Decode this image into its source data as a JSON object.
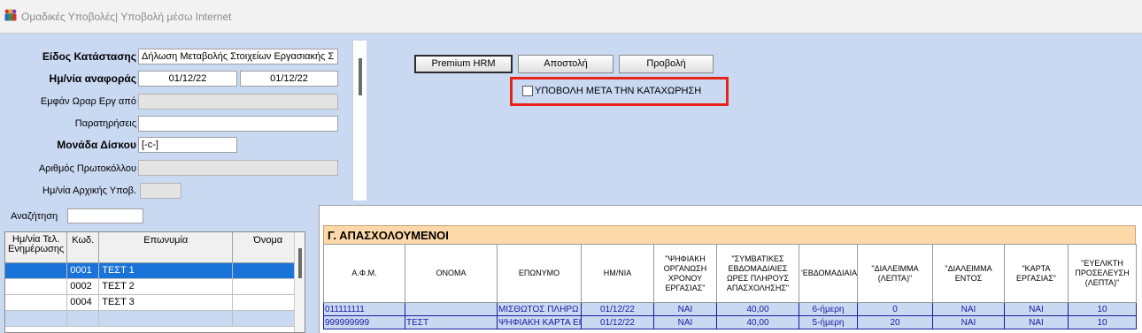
{
  "window": {
    "title": "Ομαδικές Υποβολές| Υποβολή μέσω Internet",
    "icon": "people-icon"
  },
  "form": {
    "type_label": "Είδος Κατάστασης",
    "type_value": "Δήλωση Μεταβολής Στοιχείων Εργασιακής Σ",
    "ref_date_label": "Ημ/νία αναφοράς",
    "ref_date_from": "01/12/22",
    "ref_date_to": "01/12/22",
    "show_hours_label": "Εμφάν Ωραρ Εργ από",
    "show_hours_value": "",
    "remarks_label": "Παρατηρήσεις",
    "remarks_value": "",
    "disk_label": "Μονάδα Δίσκου",
    "disk_value": "[-c-]",
    "protocol_label": "Αριθμός Πρωτοκόλλου",
    "protocol_value": "",
    "initial_date_label": "Ημ/νία Αρχικής Υποβ.",
    "initial_date_value": ""
  },
  "toolbar": {
    "premium_label": "Premium HRM",
    "send_label": "Αποστολή",
    "view_label": "Προβολή"
  },
  "option": {
    "checkbox_label": "ΥΠΟΒΟΛΗ ΜΕΤΑ ΤΗΝ ΚΑΤΑΧΩΡΗΣΗ",
    "checked": false,
    "highlight_color": "#e8231a"
  },
  "search": {
    "label": "Αναζήτηση",
    "value": ""
  },
  "left_grid": {
    "columns": [
      "Ημ/νία Τελ. Ενημέρωσης",
      "Κωδ.",
      "Επωνυμία",
      "Όνομα"
    ],
    "rows": [
      {
        "date": "",
        "code": "0001",
        "name": "ΤΕΣΤ 1",
        "first": "",
        "selected": true
      },
      {
        "date": "",
        "code": "0002",
        "name": "ΤΕΣΤ 2",
        "first": ""
      },
      {
        "date": "",
        "code": "0004",
        "name": "ΤΕΣΤ 3",
        "first": ""
      }
    ]
  },
  "employees": {
    "section_title": "Γ. ΑΠΑΣΧΟΛΟΥΜΕΝΟΙ",
    "columns": [
      "Α.Φ.Μ.",
      "ΟΝΟΜΑ",
      "ΕΠΩΝΥΜΟ",
      "ΗΜ/ΝΙΑ",
      "\"ΨΗΦΙΑΚΗ ΟΡΓΑΝΩΣΗ ΧΡΟΝΟΥ ΕΡΓΑΣΙΑΣ\"",
      "\"ΣΥΜΒΑΤΙΚΕΣ ΕΒΔΟΜΑΔΙΑΙΕΣ ΩΡΕΣ ΠΛΗΡΟΥΣ ΑΠΑΣΧΟΛΗΣΗΣ\"",
      "'ΕΒΔΟΜΑΔΙΑΙΑ",
      "\"ΔΙΑΛΕΙΜΜΑ (ΛΕΠΤΑ)\"",
      "\"ΔΙΑΛΕΙΜΜΑ ΕΝΤΟΣ",
      "\"ΚΑΡΤΑ ΕΡΓΑΣΙΑΣ\"",
      "\"ΕΥΕΛΙΚΤΗ ΠΡΟΣΕΛΕΥΣΗ (ΛΕΠΤΑ)\""
    ],
    "rows": [
      {
        "afm": "011111111",
        "first": "",
        "last": "ΜΙΣΘΩΤΟΣ ΠΛΗΡΩ",
        "date": "01/12/22",
        "digital": "ΝΑΙ",
        "hours": "40,00",
        "weekly": "6-ήμερη",
        "break_min": "0",
        "break_in": "ΝΑΙ",
        "card": "ΝΑΙ",
        "flex": "10"
      },
      {
        "afm": "999999999",
        "first": "ΤΕΣΤ",
        "last": "ΨΗΦΙΑΚΗ ΚΑΡΤΑ ΕΙ",
        "date": "01/12/22",
        "digital": "ΝΑΙ",
        "hours": "40,00",
        "weekly": "5-ήμερη",
        "break_min": "20",
        "break_in": "ΝΑΙ",
        "card": "ΝΑΙ",
        "flex": "10"
      }
    ]
  }
}
